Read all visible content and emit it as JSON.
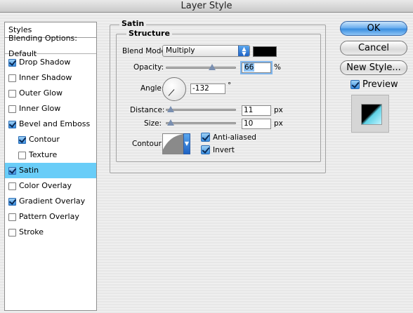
{
  "window": {
    "title": "Layer Style"
  },
  "styles_panel": {
    "header": "Styles",
    "blending": "Blending Options: Default",
    "items": [
      {
        "label": "Drop Shadow",
        "checked": true,
        "indent": false,
        "selected": false
      },
      {
        "label": "Inner Shadow",
        "checked": false,
        "indent": false,
        "selected": false
      },
      {
        "label": "Outer Glow",
        "checked": false,
        "indent": false,
        "selected": false
      },
      {
        "label": "Inner Glow",
        "checked": false,
        "indent": false,
        "selected": false
      },
      {
        "label": "Bevel and Emboss",
        "checked": true,
        "indent": false,
        "selected": false
      },
      {
        "label": "Contour",
        "checked": true,
        "indent": true,
        "selected": false
      },
      {
        "label": "Texture",
        "checked": false,
        "indent": true,
        "selected": false
      },
      {
        "label": "Satin",
        "checked": true,
        "indent": false,
        "selected": true
      },
      {
        "label": "Color Overlay",
        "checked": false,
        "indent": false,
        "selected": false
      },
      {
        "label": "Gradient Overlay",
        "checked": true,
        "indent": false,
        "selected": false
      },
      {
        "label": "Pattern Overlay",
        "checked": false,
        "indent": false,
        "selected": false
      },
      {
        "label": "Stroke",
        "checked": false,
        "indent": false,
        "selected": false
      }
    ]
  },
  "satin": {
    "group_title": "Satin",
    "structure_title": "Structure",
    "blend_mode_label": "Blend Mode:",
    "blend_mode_value": "Multiply",
    "color": "#000000",
    "opacity_label": "Opacity:",
    "opacity_value": "66",
    "opacity_unit": "%",
    "opacity_fraction": 0.66,
    "angle_label": "Angle:",
    "angle_value": "-132",
    "angle_unit": "°",
    "distance_label": "Distance:",
    "distance_value": "11",
    "distance_unit": "px",
    "size_label": "Size:",
    "size_value": "10",
    "size_unit": "px",
    "contour_label": "Contour:",
    "anti_aliased_label": "Anti-aliased",
    "invert_label": "Invert"
  },
  "buttons": {
    "ok": "OK",
    "cancel": "Cancel",
    "new_style": "New Style...",
    "preview_label": "Preview"
  }
}
